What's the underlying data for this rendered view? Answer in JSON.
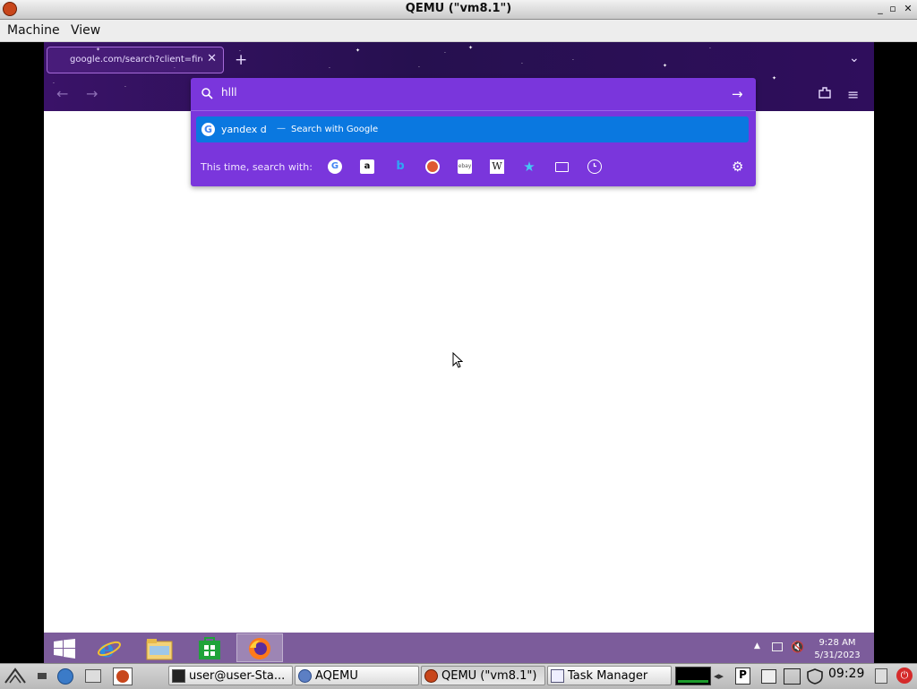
{
  "host": {
    "window_title": "QEMU (\"vm8.1\")",
    "window_buttons": [
      "_",
      "▫",
      "✕"
    ],
    "menu": [
      "Machine",
      "View"
    ]
  },
  "browser": {
    "tab_title": "google.com/search?client=firef",
    "tab_close": "✕",
    "new_tab": "+",
    "tab_list": "⌄",
    "back": "←",
    "forward": "→",
    "menu": "≡",
    "url_value": "hlll",
    "go": "→",
    "suggestion": {
      "text": "yandex d",
      "separator": "—",
      "action": "Search with Google",
      "icon": "google-icon"
    },
    "search_with_label": "This time, search with:",
    "engines": [
      "google-icon",
      "amazon-icon",
      "bing-icon",
      "duckduckgo-icon",
      "ebay-icon",
      "wikipedia-icon",
      "bookmarks-icon",
      "tabs-icon",
      "history-icon"
    ],
    "colors": {
      "accent": "#7a36dc",
      "selection": "#0a78e0",
      "header": "#2a1055"
    }
  },
  "guest_taskbar": {
    "pinned": [
      "windows-start-icon",
      "internet-explorer-icon",
      "file-explorer-icon",
      "store-icon",
      "firefox-icon"
    ],
    "time": "9:28 AM",
    "date": "5/31/2023",
    "color": "#7c5c9b"
  },
  "host_taskbar": {
    "tasks": [
      {
        "label": "user@user-Sta...",
        "icon": "terminal-icon"
      },
      {
        "label": "AQEMU",
        "icon": "aqemu-icon"
      },
      {
        "label": "QEMU (\"vm8.1\")",
        "icon": "qemu-icon"
      },
      {
        "label": "Task Manager",
        "icon": "task-manager-icon"
      }
    ],
    "clock": "09:29"
  }
}
